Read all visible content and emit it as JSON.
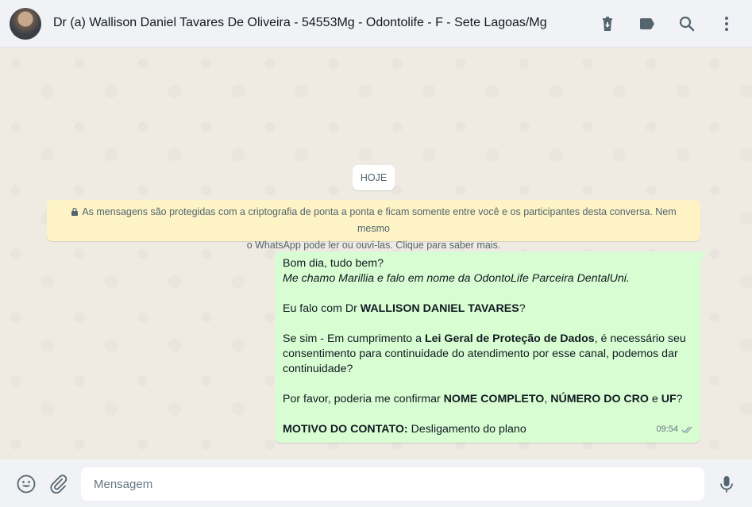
{
  "header": {
    "contact_name": "Dr (a) Wallison Daniel Tavares De Oliveira - 54553Mg - Odontolife - F - Sete Lagoas/Mg",
    "icons": [
      "delete-icon",
      "label-icon",
      "search-icon",
      "menu-icon"
    ]
  },
  "chat": {
    "date_chip": "HOJE",
    "encryption_notice_line1": "As mensagens são protegidas com a criptografia de ponta a ponta e ficam somente entre você e os participantes desta conversa. Nem mesmo",
    "encryption_notice_line2": "o WhatsApp pode ler ou ouvi-las. Clique para saber mais.",
    "message": {
      "line1": "Bom dia, tudo bem?",
      "line2_italic": "Me chamo Marillia e falo em nome da OdontoLife Parceira DentalUni.",
      "line3_pre": "Eu falo com Dr ",
      "line3_bold": "WALLISON DANIEL TAVARES",
      "line3_post": "?",
      "line4_pre": "Se sim - Em cumprimento a ",
      "line4_bold": "Lei Geral de Proteção de Dados",
      "line4_post": ", é necessário seu consentimento para continuidade do atendimento por esse canal, podemos dar continuidade?",
      "line5_pre": "Por favor, poderia me confirmar ",
      "line5_bold1": "NOME COMPLETO",
      "line5_sep1": ", ",
      "line5_bold2": "NÚMERO DO CRO",
      "line5_sep2": " e ",
      "line5_bold3": "UF",
      "line5_post": "?",
      "line6_bold": "MOTIVO DO CONTATO:",
      "line6_post": " Desligamento do plano",
      "time": "09:54",
      "status": "delivered"
    }
  },
  "footer": {
    "placeholder": "Mensagem",
    "icons": [
      "emoji-icon",
      "attach-icon",
      "microphone-icon"
    ]
  },
  "colors": {
    "header_bg": "#f0f2f5",
    "chat_bg": "#efeae2",
    "outgoing_bubble": "#d9fdd3",
    "notice_bg": "#fdf3c5",
    "icon": "#54656f"
  }
}
